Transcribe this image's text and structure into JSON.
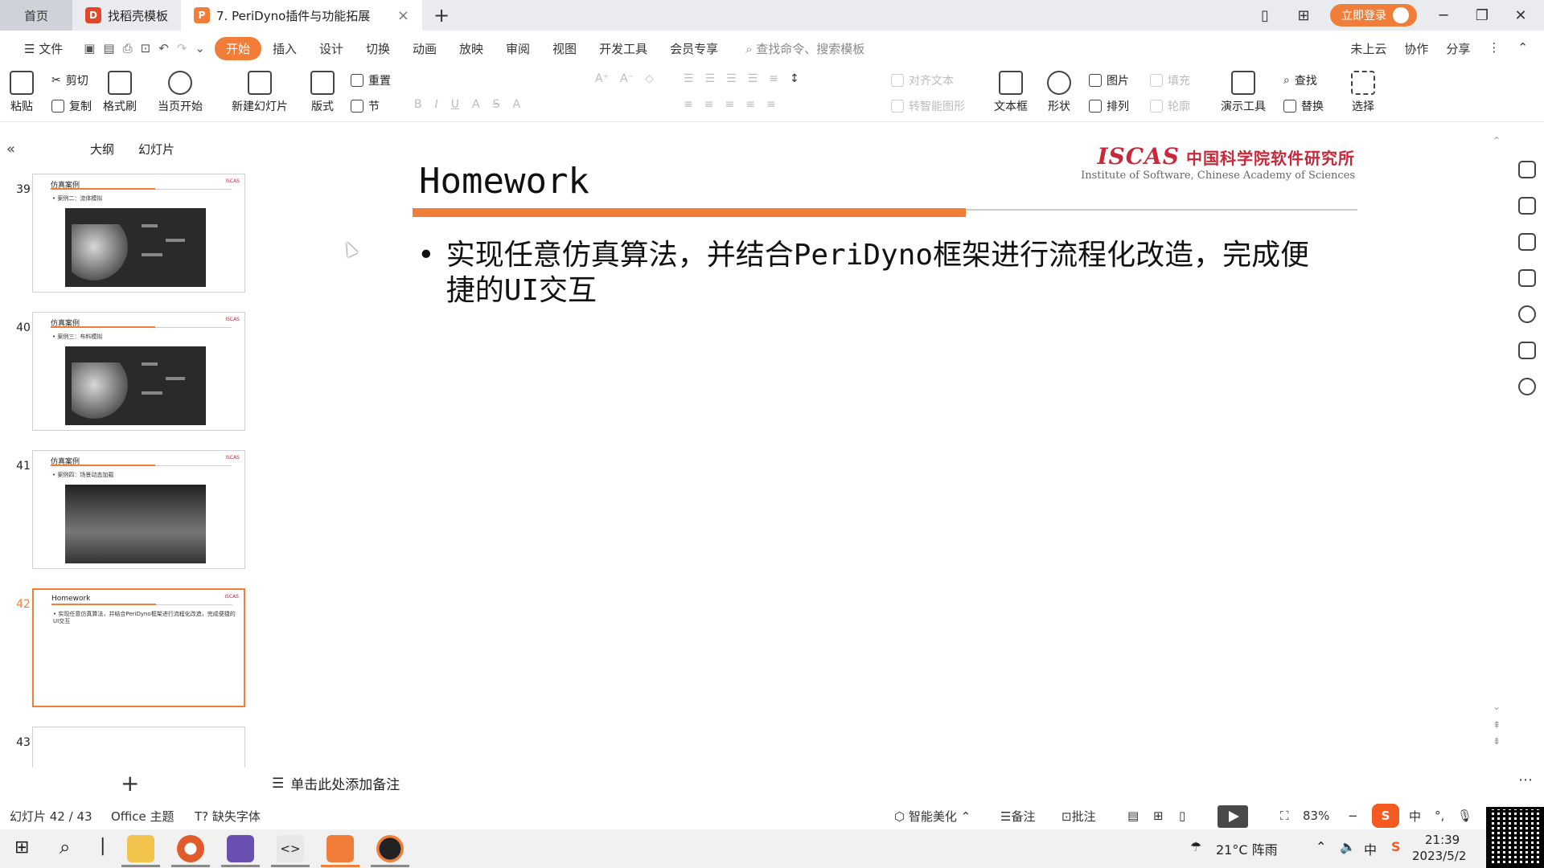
{
  "tabbar": {
    "home": "首页",
    "tabs": [
      {
        "label": "找稻壳模板",
        "icon": "daoke-icon",
        "color": "#e2472b"
      },
      {
        "label": "7. PeriDyno插件与功能拓展",
        "icon": "wps-ppt-icon",
        "color": "#f07d38"
      }
    ],
    "login": "立即登录"
  },
  "menubar": {
    "file": "文件",
    "items": [
      "开始",
      "插入",
      "设计",
      "切换",
      "动画",
      "放映",
      "审阅",
      "视图",
      "开发工具",
      "会员专享"
    ],
    "search_placeholder": "查找命令、搜索模板",
    "right": [
      "未上云",
      "协作",
      "分享"
    ]
  },
  "ribbon": {
    "paste": "粘贴",
    "cut": "剪切",
    "copy": "复制",
    "format_painter": "格式刷",
    "from_current": "当页开始",
    "new_slide": "新建幻灯片",
    "layout": "版式",
    "reset": "重置",
    "section": "节",
    "align_text": "对齐文本",
    "convert_smartart": "转智能图形",
    "textbox": "文本框",
    "shape": "形状",
    "picture": "图片",
    "fill": "填充",
    "arrange": "排列",
    "outline": "轮廓",
    "present_tools": "演示工具",
    "find": "查找",
    "replace": "替换",
    "select": "选择"
  },
  "panel": {
    "outline_tab": "大纲",
    "slides_tab": "幻灯片"
  },
  "thumbnails": [
    {
      "num": "39",
      "title": "仿真案例",
      "bullet": "• 案例二：流体模拟"
    },
    {
      "num": "40",
      "title": "仿真案例",
      "bullet": "• 案例三：布料模拟"
    },
    {
      "num": "41",
      "title": "仿真案例",
      "bullet": "• 案例四：场景动态加载"
    },
    {
      "num": "42",
      "title": "Homework",
      "bullet": "• 实现任意仿真算法，并结合PeriDyno框架进行流程化改造，完成便捷的UI交互"
    },
    {
      "num": "43",
      "title": "",
      "bullet": ""
    }
  ],
  "slide": {
    "title": "Homework",
    "logo_main": "ISCAS",
    "logo_cn": "中国科学院软件研究所",
    "logo_en": "Institute of Software, Chinese Academy of Sciences",
    "bullet": "实现任意仿真算法，并结合PeriDyno框架进行流程化改造，完成便捷的UI交互",
    "accent_color": "#f07d38"
  },
  "notes": {
    "placeholder": "单击此处添加备注"
  },
  "status": {
    "slide_counter": "幻灯片 42 / 43",
    "theme": "Office 主题",
    "missing_font": "缺失字体",
    "beautify": "智能美化",
    "notes": "备注",
    "comments": "批注",
    "zoom": "83%"
  },
  "taskbar": {
    "weather": "21°C 阵雨",
    "time": "21:39",
    "date": "2023/5/2",
    "ime": "中"
  }
}
